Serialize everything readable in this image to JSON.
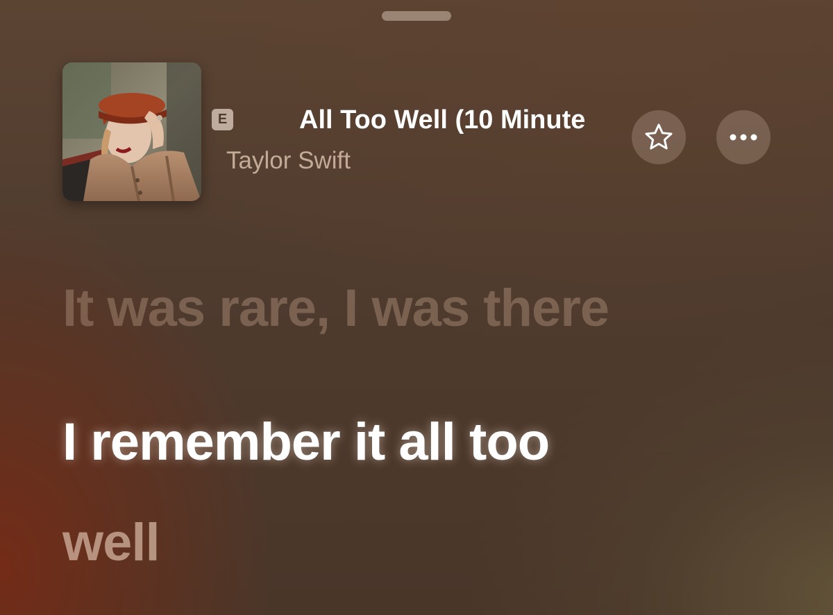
{
  "sheet": {
    "grabber_icon": "grabber-handle-icon"
  },
  "now_playing": {
    "artwork_icon": "album-artwork",
    "explicit_badge": "E",
    "title": "All Too Well (10 Minute",
    "artist": "Taylor Swift",
    "favorite_icon": "star-outline-icon",
    "more_icon": "ellipsis-icon"
  },
  "lyrics": {
    "previous_line": "It was rare, I was there",
    "current_line": "I remember it all too",
    "next_line": "well"
  },
  "colors": {
    "background": "#4e3b2e",
    "primary_text": "#ffffff",
    "accent_warm": "#7a2a14"
  }
}
